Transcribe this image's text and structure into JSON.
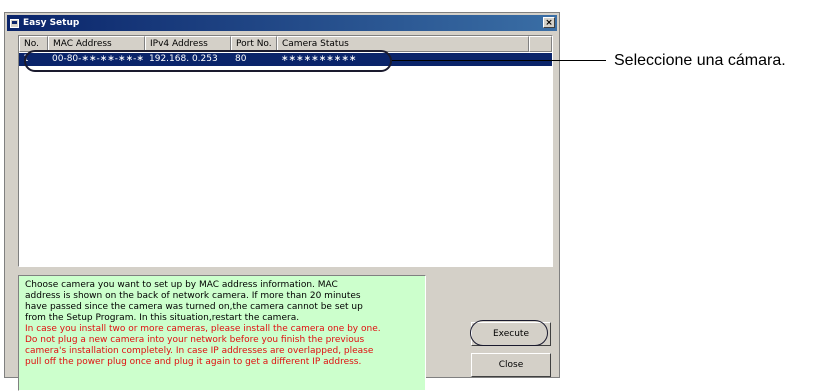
{
  "window": {
    "title": "Easy Setup",
    "close_glyph": "×"
  },
  "table": {
    "columns": [
      "No.",
      "MAC Address",
      "IPv4 Address",
      "Port No.",
      "Camera Status",
      ""
    ],
    "rows": [
      {
        "no": "1",
        "mac": "00-80-∗∗-∗∗-∗∗-∗∗",
        "ipv4": "192.168.  0.253",
        "port": "80",
        "status": "∗∗∗∗∗∗∗∗∗∗"
      }
    ]
  },
  "callout": {
    "text": "Seleccione una cámara."
  },
  "info": {
    "lines": [
      {
        "text": "Choose camera you want to set up by MAC address information. MAC",
        "color": "black"
      },
      {
        "text": "address is shown on the back of network camera. If more than 20 minutes",
        "color": "black"
      },
      {
        "text": "have passed since the camera was turned on,the camera cannot be set up",
        "color": "black"
      },
      {
        "text": "from the Setup Program. In this situation,restart the camera.",
        "color": "black"
      },
      {
        "text": "In case you install two or more cameras, please install the camera one by one.",
        "color": "red"
      },
      {
        "text": "Do not plug a new camera into your network before you finish the previous",
        "color": "red"
      },
      {
        "text": "camera's installation completely. In case IP addresses are overlapped, please",
        "color": "red"
      },
      {
        "text": "pull off the power plug once and plug it again to get a different IP address.",
        "color": "red"
      }
    ]
  },
  "buttons": {
    "execute": "Execute",
    "close": "Close"
  },
  "colors": {
    "selection": "#0a246a",
    "info_bg": "#ccffcc",
    "warning_text": "#e01010"
  }
}
